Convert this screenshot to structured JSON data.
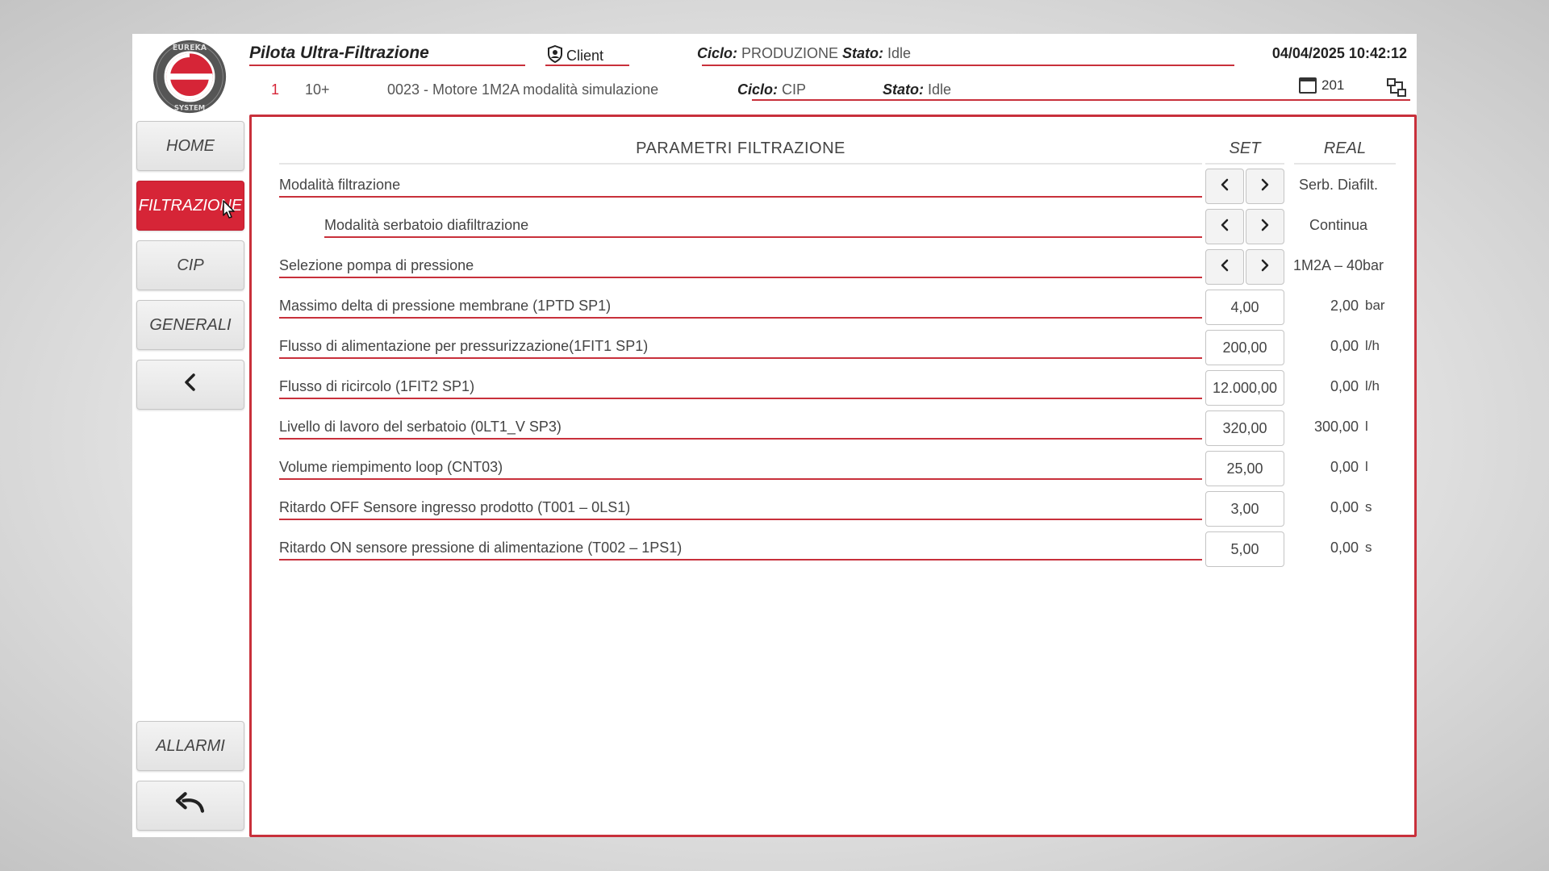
{
  "header": {
    "title": "Pilota Ultra-Filtrazione",
    "client": "Client",
    "ciclo_label": "Ciclo:",
    "ciclo1_value": "PRODUZIONE",
    "stato_label": "Stato:",
    "stato1_value": "Idle",
    "datetime": "04/04/2025 10:42:12",
    "alarm_index": "1",
    "alarm_count": "10+",
    "alarm_message": "0023 - Motore 1M2A modalità simulazione",
    "ciclo2_value": "CIP",
    "stato2_value": "Idle",
    "window_number": "201"
  },
  "sidebar": {
    "home": "HOME",
    "filtrazione": "FILTRAZIONE",
    "cip": "CIP",
    "generali": "GENERALI",
    "allarmi": "ALLARMI"
  },
  "panel": {
    "title": "PARAMETRI FILTRAZIONE",
    "col_set": "SET",
    "col_real": "REAL",
    "rows": [
      {
        "label": "Modalità filtrazione",
        "real": "Serb. Diafilt."
      },
      {
        "label": "Modalità serbatoio diafiltrazione",
        "real": "Continua"
      },
      {
        "label": "Selezione pompa di pressione",
        "real": "1M2A – 40bar"
      },
      {
        "label": "Massimo delta di pressione membrane (1PTD SP1)",
        "set": "4,00",
        "real": "2,00",
        "unit": "bar"
      },
      {
        "label": "Flusso di alimentazione per pressurizzazione(1FIT1 SP1)",
        "set": "200,00",
        "real": "0,00",
        "unit": "l/h"
      },
      {
        "label": "Flusso di ricircolo (1FIT2 SP1)",
        "set": "12.000,00",
        "real": "0,00",
        "unit": "l/h"
      },
      {
        "label": "Livello di lavoro del serbatoio (0LT1_V SP3)",
        "set": "320,00",
        "real": "300,00",
        "unit": "l"
      },
      {
        "label": "Volume riempimento loop (CNT03)",
        "set": "25,00",
        "real": "0,00",
        "unit": "l"
      },
      {
        "label": "Ritardo OFF Sensore ingresso prodotto (T001 – 0LS1)",
        "set": "3,00",
        "real": "0,00",
        "unit": "s"
      },
      {
        "label": "Ritardo ON sensore pressione di alimentazione (T002 – 1PS1)",
        "set": "5,00",
        "real": "0,00",
        "unit": "s"
      }
    ]
  },
  "colors": {
    "accent": "#c8303b",
    "active_button": "#d62537"
  },
  "icons": {
    "logo": "eureka-system-logo",
    "client": "shield-icon",
    "window": "window-icon",
    "network": "network-icon",
    "back": "chevron-left-icon",
    "undo": "undo-icon"
  }
}
